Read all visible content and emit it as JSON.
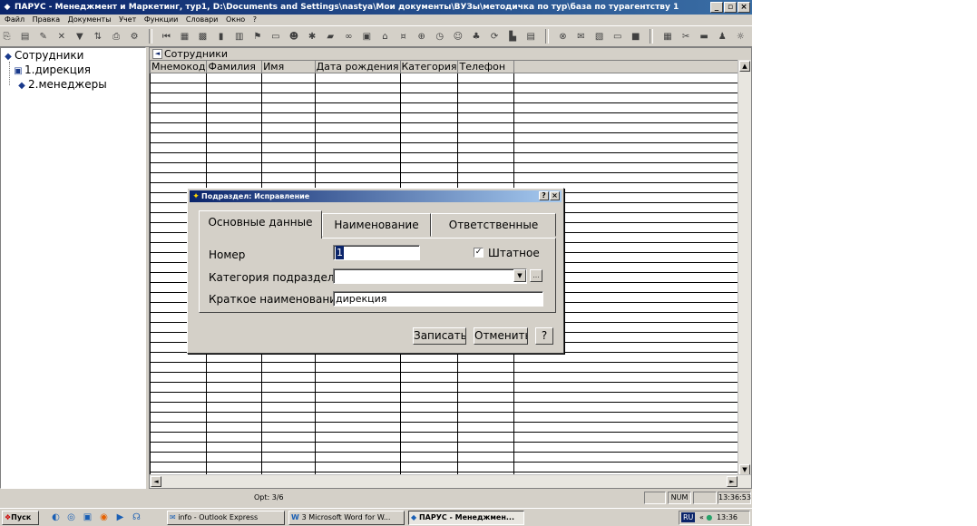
{
  "window": {
    "title": "ПАРУС - Менеджмент и Маркетинг, тур1, D:\\Documents and Settings\\nastya\\Мои документы\\ВУЗы\\методичка по тур\\база по турагентству 1",
    "minimize": "_",
    "maximize": "▫",
    "close": "×"
  },
  "menu": {
    "items": [
      "Файл",
      "Правка",
      "Документы",
      "Учет",
      "Функции",
      "Словари",
      "Окно",
      "?"
    ]
  },
  "tree": {
    "root": "Сотрудники",
    "children": [
      "1.дирекция",
      "2.менеджеры"
    ]
  },
  "grid": {
    "caption": "Сотрудники",
    "columns": [
      "Мнемокод",
      "Фамилия",
      "Имя",
      "Дата рождения",
      "Категория",
      "Телефон"
    ]
  },
  "dialog": {
    "title": "Подраздел: Исправление",
    "help_btn": "?",
    "close_btn": "×",
    "tabs": [
      "Основные данные",
      "Наименование",
      "Ответственные"
    ],
    "fields": {
      "number_label": "Номер",
      "number_value": "1",
      "staff_label": "Штатное",
      "staff_checked": "✓",
      "category_label": "Категория подразделения",
      "category_value": "",
      "short_name_label": "Краткое наименование",
      "short_name_value": "дирекция"
    },
    "buttons": {
      "save": "Записать",
      "cancel": "Отменить",
      "help": "?"
    }
  },
  "status": {
    "text": "Opt: 3/6",
    "num": "NUM",
    "time": "13:36:53"
  },
  "taskbar": {
    "start": "Пуск",
    "tasks": [
      "info - Outlook Express",
      "3 Microsoft Word for W...",
      "ПАРУС - Менеджмен..."
    ],
    "lang": "RU",
    "clock": "13:36"
  }
}
